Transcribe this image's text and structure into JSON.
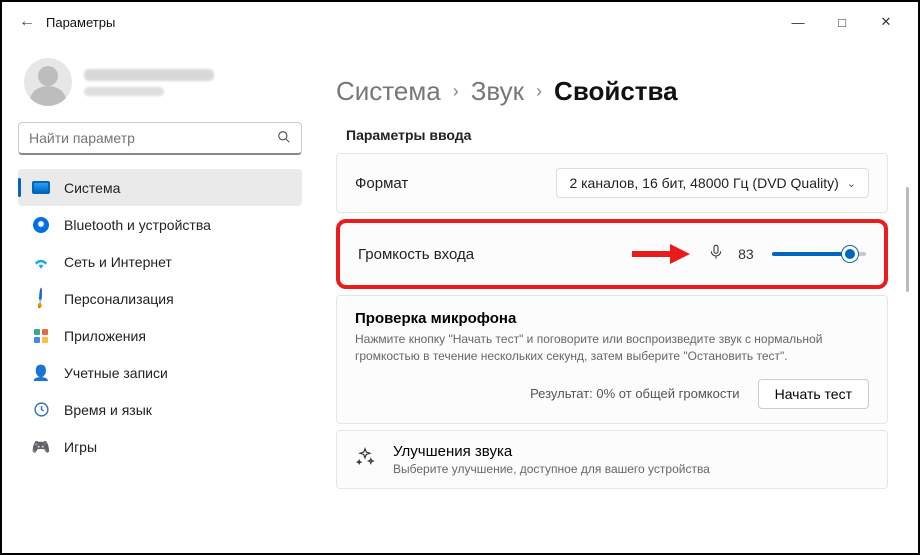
{
  "titlebar": {
    "title": "Параметры"
  },
  "search": {
    "placeholder": "Найти параметр"
  },
  "nav": {
    "items": [
      {
        "label": "Система"
      },
      {
        "label": "Bluetooth и устройства"
      },
      {
        "label": "Сеть и Интернет"
      },
      {
        "label": "Персонализация"
      },
      {
        "label": "Приложения"
      },
      {
        "label": "Учетные записи"
      },
      {
        "label": "Время и язык"
      },
      {
        "label": "Игры"
      }
    ]
  },
  "breadcrumb": {
    "a": "Система",
    "b": "Звук",
    "c": "Свойства"
  },
  "section": {
    "input_params": "Параметры ввода"
  },
  "format": {
    "label": "Формат",
    "value": "2 каналов, 16 бит, 48000 Гц (DVD Quality)"
  },
  "volume": {
    "label": "Громкость входа",
    "value": 83,
    "percent": 83
  },
  "mictest": {
    "title": "Проверка микрофона",
    "desc": "Нажмите кнопку \"Начать тест\" и поговорите или воспроизведите звук с нормальной громкостью в течение нескольких секунд, затем выберите \"Остановить тест\".",
    "result": "Результат: 0% от общей громкости",
    "button": "Начать тест"
  },
  "enhance": {
    "title": "Улучшения звука",
    "desc": "Выберите улучшение, доступное для вашего устройства"
  }
}
